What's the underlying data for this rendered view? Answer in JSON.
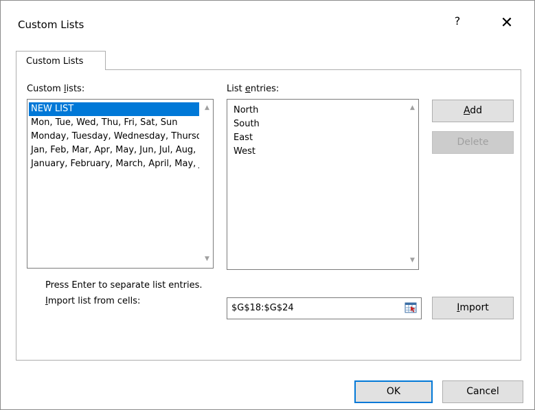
{
  "window": {
    "title": "Custom Lists",
    "help_glyph": "?",
    "close_glyph": "✕"
  },
  "tabs": [
    {
      "label": "Custom Lists"
    }
  ],
  "custom_lists": {
    "label_pre": "Custom ",
    "label_ul": "l",
    "label_post": "ists:",
    "items": [
      {
        "label": "NEW LIST",
        "selected": true
      },
      {
        "label": "Mon, Tue, Wed, Thu, Fri, Sat, Sun",
        "selected": false
      },
      {
        "label": "Monday, Tuesday, Wednesday, Thursday, Friday, Saturday, Sunday",
        "selected": false
      },
      {
        "label": "Jan, Feb, Mar, Apr, May, Jun, Jul, Aug, Sep, Oct, Nov, Dec",
        "selected": false
      },
      {
        "label": "January, February, March, April, May, June, July, August, September, October, November, December",
        "selected": false
      }
    ]
  },
  "list_entries": {
    "label_pre": "List ",
    "label_ul": "e",
    "label_post": "ntries:",
    "lines": [
      "North",
      "South",
      "East",
      "West"
    ]
  },
  "buttons": {
    "add_ul": "A",
    "add_post": "dd",
    "delete": "Delete",
    "import_ul": "I",
    "import_post": "mport",
    "ok": "OK",
    "cancel": "Cancel"
  },
  "hint": "Press Enter to separate list entries.",
  "import": {
    "label_ul": "I",
    "label_post": "mport list from cells:",
    "value": "$G$18:$G$24"
  },
  "colors": {
    "selection": "#0078d7",
    "button_face": "#e1e1e1",
    "disabled_text": "#a0a0a0"
  },
  "icons": {
    "scroll_up": "▲",
    "scroll_down": "▼"
  }
}
